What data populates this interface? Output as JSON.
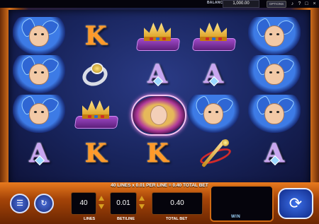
{
  "topbar": {
    "balance_label": "BALANCE",
    "balance_value": "1,000.00",
    "options_label": "OPTIONS",
    "volume_icon": "speaker-icon",
    "help_icon": "question-icon",
    "close_icon": "close-icon",
    "fullscreen_icon": "fullscreen-icon"
  },
  "reels": {
    "columns": 5,
    "rows": 4,
    "grid": [
      [
        "jester",
        "K",
        "crown",
        "crown",
        "jester"
      ],
      [
        "jester",
        "ring",
        "A",
        "A",
        "jester"
      ],
      [
        "jester",
        "crown",
        "princess",
        "jester",
        "jester"
      ],
      [
        "A",
        "K",
        "K",
        "scepter",
        "A"
      ]
    ],
    "letter_K": "K",
    "letter_A": "A"
  },
  "panel": {
    "bet_summary": "40 LINES x 0.01 PER LINE = 0.40 TOTAL BET",
    "lines_value": "40",
    "bet_per_line_value": "0.01",
    "total_bet_value": "0.40",
    "lines_label": "LINES",
    "bet_per_line_label": "BET/LINE",
    "total_bet_label": "TOTAL BET",
    "win_label": "WIN",
    "paytable_icon": "paytable-icon",
    "autoplay_icon": "autoplay-icon",
    "spin_icon": "spin-arrow-icon",
    "spin_glyph": "⟳"
  },
  "colors": {
    "frame_orange": "#d8731c",
    "reel_blue": "#18245c",
    "k_orange": "#ff9a2a",
    "a_purple": "#c8a6f0"
  }
}
